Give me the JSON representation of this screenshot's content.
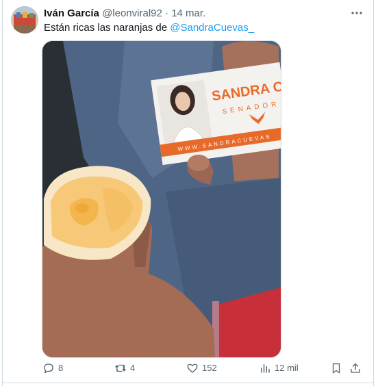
{
  "tweet": {
    "author_name": "Iván García",
    "handle": "@leonviral92",
    "separator": "·",
    "date": "14 mar.",
    "text_before": "Están ricas las naranjas de ",
    "mention": "@SandraCuevas_"
  },
  "media": {
    "card_name": "SANDRA CUE",
    "card_role": "SENADOR",
    "card_url": "WWW.SANDRACUEVAS",
    "card_accent": "#e86a2b"
  },
  "actions": {
    "replies": "8",
    "retweets": "4",
    "likes": "152",
    "views": "12 mil"
  },
  "icons": [
    "more-icon",
    "reply-icon",
    "retweet-icon",
    "like-icon",
    "views-icon",
    "bookmark-icon",
    "share-icon"
  ],
  "colors": {
    "link": "#1d9bf0",
    "secondary": "#536471",
    "text": "#0f1419"
  }
}
